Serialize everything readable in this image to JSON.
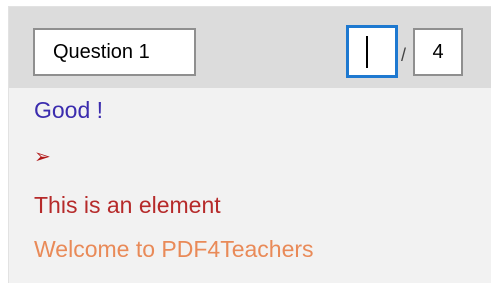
{
  "toolbar": {
    "question_value": "Question 1",
    "page_input_value": "",
    "page_separator": "/",
    "page_total": "4"
  },
  "elements": [
    {
      "text": "Good !",
      "color": "#3b2cae"
    },
    {
      "text": "➢",
      "color": "#b01616"
    },
    {
      "text": "This is an element",
      "color": "#b62a2a"
    },
    {
      "text": "Welcome to PDF4Teachers",
      "color": "#e98a58"
    }
  ]
}
